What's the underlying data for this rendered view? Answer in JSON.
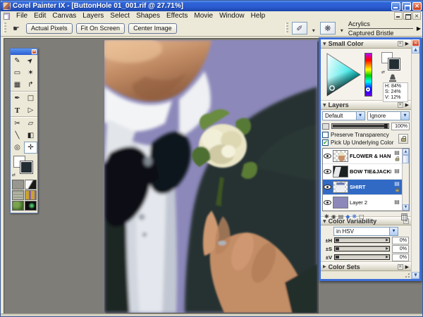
{
  "window": {
    "title": "Corel Painter IX - [ButtonHole 01_001.rif @ 27.71%]"
  },
  "colors": {
    "selected_row": "#316AC5",
    "canvas_background": "#8C88BA",
    "titlebar_blue": "#2E63D8",
    "current_paint_color": "#232E33"
  },
  "icons": {
    "close": "×",
    "check": "✔",
    "flyout": "▶",
    "collapse_open": "▼",
    "collapse_closed": "▶",
    "dropdown": "▼",
    "scroll_up": "▲",
    "scroll_down": "▼",
    "pan_hand": "☛",
    "brush_well": "✐",
    "dab_well": "❋",
    "stack": "▤",
    "swap": "⇄",
    "layer_cmd_1": "✱",
    "layer_cmd_2": "◉",
    "layer_cmd_3": "▤",
    "layer_cmd_4": "◆",
    "layer_cmd_5": "❋",
    "layer_cmd_6": "□",
    "cv_arrow": "▶"
  },
  "menu": {
    "items": [
      "File",
      "Edit",
      "Canvas",
      "Layers",
      "Select",
      "Shapes",
      "Effects",
      "Movie",
      "Window",
      "Help"
    ]
  },
  "toolbar": {
    "actual_pixels": "Actual Pixels",
    "fit_on_screen": "Fit On Screen",
    "center_image": "Center Image",
    "brush_category": "Acrylics",
    "brush_variant": "Captured Bristle"
  },
  "toolbox": {
    "tools": [
      {
        "name": "brush",
        "glyph": "✎"
      },
      {
        "name": "layer-adjuster",
        "glyph": "➤"
      },
      {
        "name": "rectangular-selection",
        "glyph": "▭"
      },
      {
        "name": "magic-wand",
        "glyph": "✶"
      },
      {
        "name": "crop",
        "glyph": "▦"
      },
      {
        "name": "selection-adjuster",
        "glyph": "↱"
      },
      {
        "name": "pen",
        "glyph": "✒"
      },
      {
        "name": "rectangular-shape",
        "glyph": "□"
      },
      {
        "name": "text",
        "glyph": "T"
      },
      {
        "name": "shape-selection",
        "glyph": "▷"
      },
      {
        "name": "scissors",
        "glyph": "✂"
      },
      {
        "name": "eraser",
        "glyph": "▱"
      },
      {
        "name": "dropper",
        "glyph": "╲"
      },
      {
        "name": "paint-bucket",
        "glyph": "◧"
      },
      {
        "name": "magnifier",
        "glyph": "◎"
      },
      {
        "name": "grabber",
        "glyph": "✛"
      }
    ]
  },
  "panels": {
    "small_color": {
      "title": "Small Color",
      "hsv": {
        "h": "H: 84%",
        "s": "S: 24%",
        "v": "V: 12%"
      }
    },
    "layers": {
      "title": "Layers",
      "composite_method": "Default",
      "composite_depth": "Ignore",
      "opacity": "100%",
      "preserve_transparency_label": "Preserve Transparency",
      "pick_up_label": "Pick Up Underlying Color",
      "rows": [
        {
          "name": "FLOWER & HAND"
        },
        {
          "name": "BOW TIE&JACKET"
        },
        {
          "name": "SHIRT"
        },
        {
          "name": "Layer 2"
        }
      ]
    },
    "color_variability": {
      "title": "Color Variability",
      "mode": "in HSV",
      "sliders": [
        {
          "label": "±H",
          "value": "0%"
        },
        {
          "label": "±S",
          "value": "0%"
        },
        {
          "label": "±V",
          "value": "0%"
        }
      ]
    },
    "color_sets": {
      "title": "Color Sets"
    }
  }
}
